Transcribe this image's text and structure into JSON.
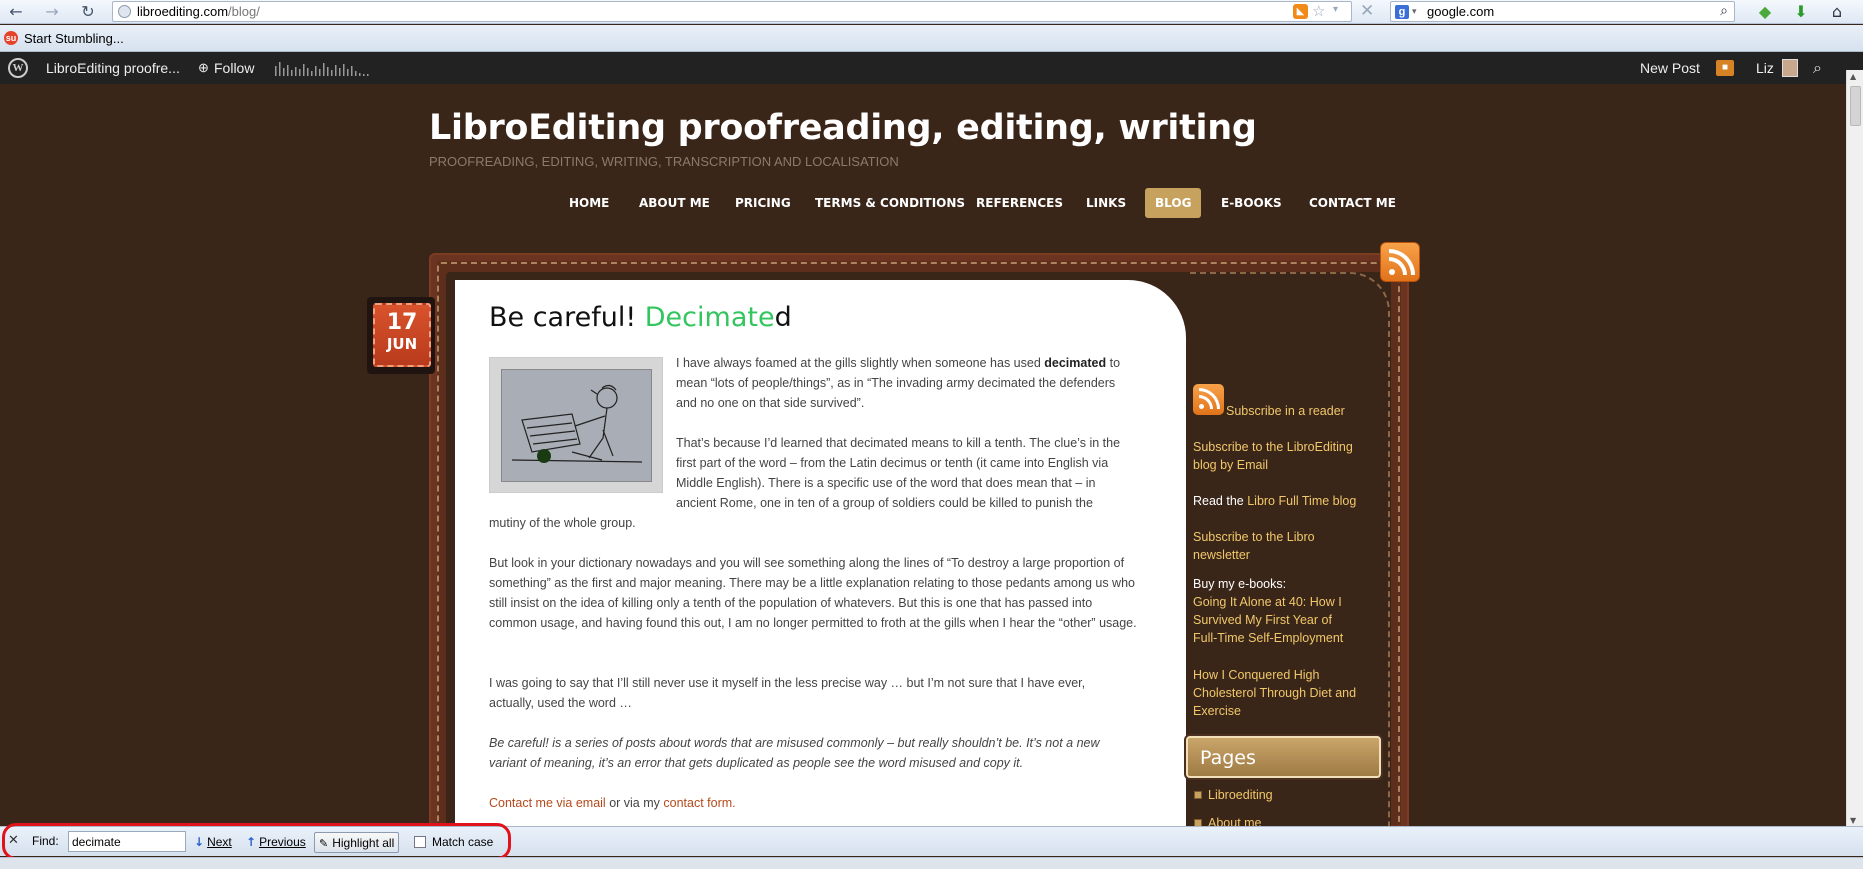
{
  "browser": {
    "url_domain": "libroediting.com",
    "url_path": "/blog/",
    "search_engine_text": "google.com",
    "bookmark": "Start Stumbling..."
  },
  "wpbar": {
    "site_name": "LibroEditing proofre...",
    "follow": "Follow",
    "new_post": "New Post",
    "user": "Liz"
  },
  "site": {
    "title": "LibroEditing proofreading, editing, writing",
    "tagline": "PROOFREADING, EDITING, WRITING, TRANSCRIPTION AND LOCALISATION",
    "menu": [
      "HOME",
      "ABOUT ME",
      "PRICING",
      "TERMS & CONDITIONS",
      "REFERENCES",
      "LINKS",
      "BLOG",
      "E-BOOKS",
      "CONTACT ME"
    ],
    "active_menu": "BLOG"
  },
  "post": {
    "date_day": "17",
    "date_month": "JUN",
    "title_pre": "Be careful! ",
    "title_highlight": "Decimate",
    "title_post": "d",
    "p1_a": "I have always foamed at the gills slightly when someone has used ",
    "p1_bold": "decimated",
    "p1_b": "to mean “lots of people/things”, as in “The invading army decimated the defenders and no one on that side survived”.",
    "p2_a": "That’s because I’d learned that decimated means to kill a tenth. The clue’s in the first part of the word – from the Latin decimus or tenth (it came into English via Middle English). There is a specific use of the word that does mean that – in ancient Rome, one in ten of a group of soldiers could be killed to punish the",
    "p2_b": "mutiny of the whole group.",
    "p3": "But look in your dictionary nowadays and you will see something along the lines of “To destroy a large proportion of something” as the first and major meaning. There may be a little explanation relating to those pedants among us who still insist on the idea of killing only a tenth of the population of whatevers. But this is one that has passed into common usage, and having found this out, I am no longer permitted to froth at the gills when I hear the “other” usage.",
    "p4": "I was going to say that I’ll still never use it myself in the less precise way … but I’m not sure that I have ever, actually, used the word …",
    "p5": "Be careful! is a series of posts about words that are misused commonly – but really shouldn’t be. It’s not a new variant of meaning, it’s an error that gets duplicated as people see the word misused and copy it.",
    "contact_email": "Contact me via email",
    "contact_mid": " or via my ",
    "contact_form": "contact form",
    "contact_end": "."
  },
  "sidebar": {
    "subscribe_reader": "Subscribe in a reader",
    "subscribe_email": "Subscribe to the LibroEditing blog by Email",
    "read_prefix": "Read the ",
    "read_link": "Libro Full Time blog",
    "newsletter": "Subscribe to the Libro newsletter",
    "buy": "Buy my e-books:",
    "ebook1": "Going It Alone at 40: How I Survived My First Year of Full-Time Self-Employment",
    "ebook2": "How I Conquered High Cholesterol Through Diet and Exercise",
    "pages_heading": "Pages",
    "pages": [
      "Libroediting",
      "About me"
    ]
  },
  "findbar": {
    "label": "Find:",
    "value": "decimate",
    "next": "Next",
    "previous": "Previous",
    "highlight_all": "Highlight all",
    "match_case": "Match case"
  },
  "colors": {
    "background": "#3a2519",
    "highlight": "#33c55e",
    "accent": "#c6a25e",
    "link": "#b44a1c"
  }
}
